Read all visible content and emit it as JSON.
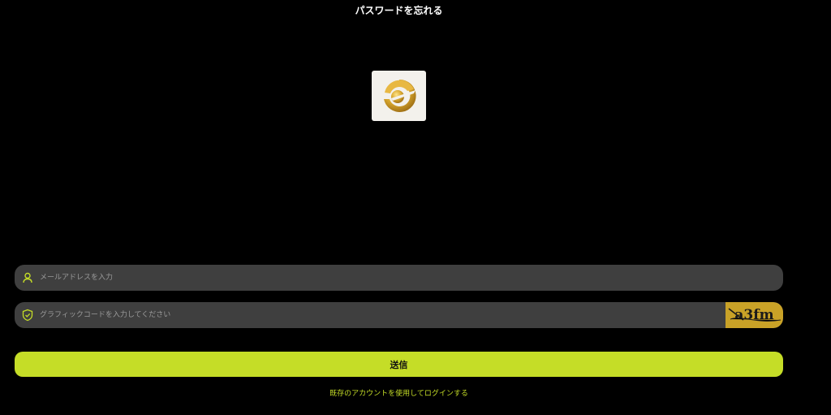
{
  "header": {
    "title": "パスワードを忘れる"
  },
  "form": {
    "email": {
      "placeholder": "メールアドレスを入力",
      "value": "",
      "icon": "user-icon"
    },
    "captcha": {
      "placeholder": "グラフィックコードを入力してください",
      "value": "",
      "icon": "shield-check-icon",
      "image_text": "a3fm"
    },
    "submit_label": "送信"
  },
  "footer": {
    "login_link": "既存のアカウントを使用してログインする"
  },
  "colors": {
    "background": "#000000",
    "accent": "#c5dd27",
    "field_bg": "#3f3f3f",
    "captcha_bg": "#c9a227"
  }
}
